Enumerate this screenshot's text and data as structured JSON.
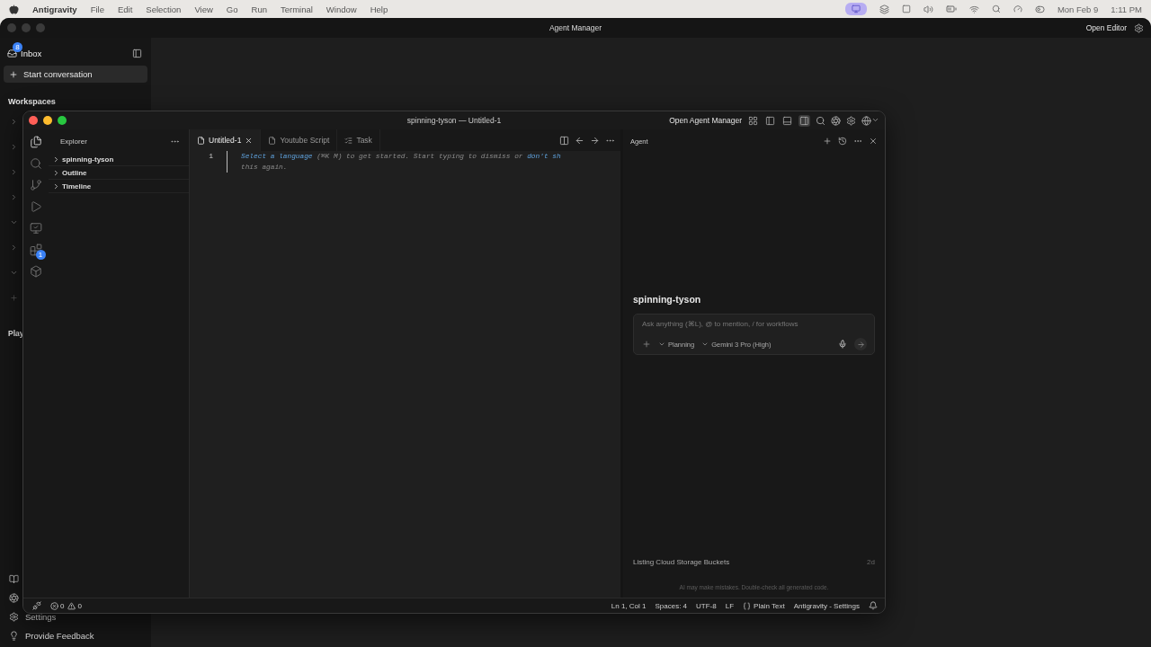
{
  "menu_bar": {
    "app_name": "Antigravity",
    "menus": [
      "File",
      "Edit",
      "Selection",
      "View",
      "Go",
      "Run",
      "Terminal",
      "Window",
      "Help"
    ],
    "date": "Mon Feb 9",
    "time": "1:11 PM"
  },
  "manager": {
    "title": "Agent Manager",
    "open_editor": "Open Editor",
    "inbox": {
      "label": "Inbox",
      "badge": "8"
    },
    "start_conversation": "Start conversation",
    "workspaces_heading": "Workspaces",
    "workspace_rows": [
      {
        "expanded": false
      },
      {
        "expanded": false
      },
      {
        "expanded": false
      },
      {
        "expanded": false
      },
      {
        "expanded": true
      },
      {
        "expanded": false
      },
      {
        "expanded": true
      }
    ],
    "playground_heading": "Play",
    "footer": [
      {
        "kind": "docs"
      },
      {
        "kind": "browser"
      },
      {
        "kind": "settings",
        "label": "Settings"
      },
      {
        "kind": "feedback",
        "label": "Provide Feedback"
      }
    ]
  },
  "editor": {
    "title": "spinning-tyson — Untitled-1",
    "open_agent_manager": "Open Agent Manager",
    "layout_toggles": [
      {
        "kind": "customize",
        "selected": false
      },
      {
        "kind": "left",
        "selected": false
      },
      {
        "kind": "bottom",
        "selected": false
      },
      {
        "kind": "right",
        "selected": true
      }
    ],
    "activity": [
      {
        "kind": "files",
        "selected": true
      },
      {
        "kind": "search",
        "selected": false
      },
      {
        "kind": "git",
        "selected": false
      },
      {
        "kind": "run",
        "selected": false
      },
      {
        "kind": "remote",
        "selected": false
      },
      {
        "kind": "extensions",
        "selected": false,
        "badge": "1"
      },
      {
        "kind": "cube",
        "selected": false
      }
    ],
    "explorer": {
      "title": "Explorer",
      "sections": [
        {
          "label": "spinning-tyson",
          "expanded": false
        },
        {
          "label": "Outline",
          "expanded": false
        },
        {
          "label": "Timeline",
          "expanded": false
        }
      ]
    },
    "tabs": [
      {
        "label": "Untitled-1",
        "kind": "file",
        "selected": true
      },
      {
        "label": "Youtube Script",
        "kind": "file",
        "selected": false
      },
      {
        "label": "Task",
        "kind": "task",
        "selected": false
      }
    ],
    "line_number": "1",
    "hint_lines": [
      [
        {
          "text": "Select a language",
          "link": true
        },
        {
          "text": " (⌘K M) to get started. Start typing to dismiss or ",
          "link": false
        },
        {
          "text": "don't sh",
          "link": true
        }
      ],
      [
        {
          "text": "this again.",
          "link": false
        }
      ]
    ],
    "agent": {
      "title": "Agent",
      "workspace": "spinning-tyson",
      "placeholder": "Ask anything (⌘L), @ to mention, / for workflows",
      "mode": "Planning",
      "model": "Gemini 3 Pro (High)",
      "conversations": [
        {
          "title": "Listing Cloud Storage Buckets",
          "age": "2d"
        }
      ],
      "disclaimer": "AI may make mistakes. Double-check all generated code."
    },
    "status_bar": {
      "errors": "0",
      "warnings": "0",
      "items": [
        {
          "kind": "text",
          "label": "Ln 1, Col 1"
        },
        {
          "kind": "text",
          "label": "Spaces: 4"
        },
        {
          "kind": "text",
          "label": "UTF-8"
        },
        {
          "kind": "text",
          "label": "LF"
        },
        {
          "kind": "language",
          "label": "Plain Text"
        },
        {
          "kind": "text",
          "label": "Antigravity - Settings"
        }
      ]
    }
  }
}
